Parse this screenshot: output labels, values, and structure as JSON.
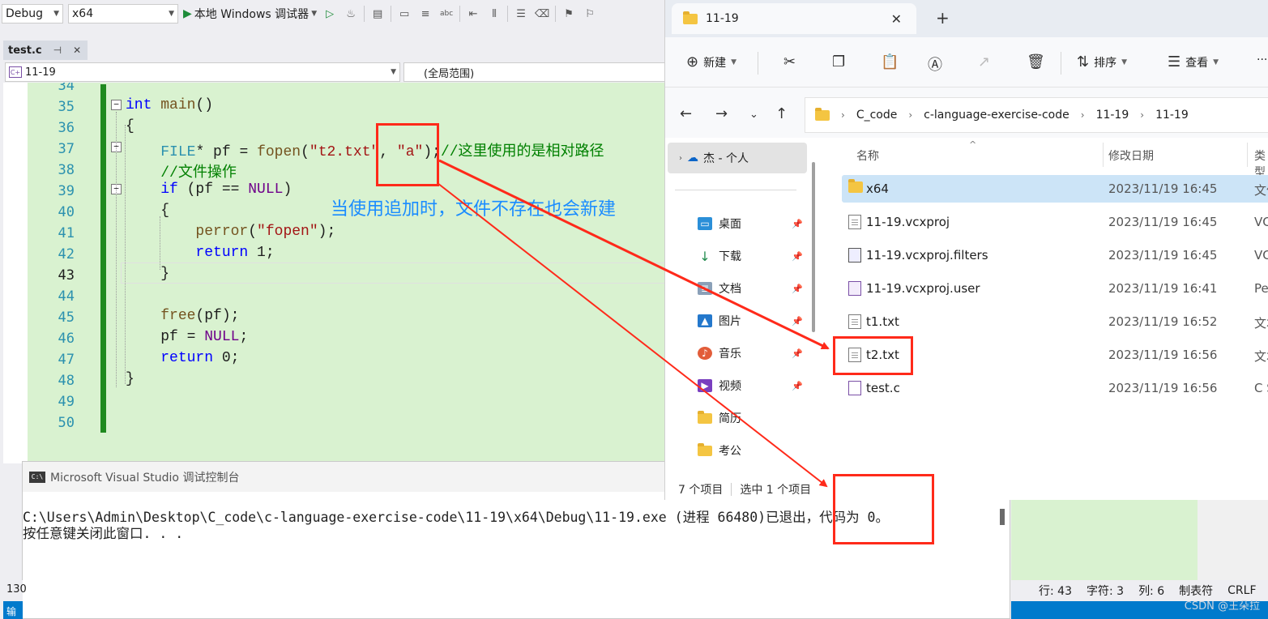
{
  "toolbar": {
    "config": "Debug",
    "platform": "x64",
    "run_label": "本地 Windows 调试器"
  },
  "doc_tab": {
    "name": "test.c",
    "pin": "⊣",
    "close": "✕"
  },
  "navbar": {
    "file_scope": "11-19",
    "global_scope": "(全局范围)"
  },
  "code": {
    "line_numbers": [
      "34",
      "35",
      "36",
      "37",
      "38",
      "39",
      "40",
      "41",
      "42",
      "43",
      "44",
      "45",
      "46",
      "47",
      "48",
      "49",
      "50"
    ],
    "current_line": "43"
  },
  "annotation": "当使用追加时，文件不存在也会新建",
  "console": {
    "title": "Microsoft Visual Studio 调试控制台",
    "icon": "C:\\",
    "line1": "C:\\Users\\Admin\\Desktop\\C_code\\c-language-exercise-code\\11-19\\x64\\Debug\\11-19.exe (进程 66480)已退出，代码为 0。",
    "line2": "按任意键关闭此窗口. . ."
  },
  "explorer": {
    "tab_title": "11-19",
    "cmd": {
      "new": "新建",
      "sort": "排序",
      "view": "查看",
      "more": "···"
    },
    "breadcrumb": [
      "C_code",
      "c-language-exercise-code",
      "11-19",
      "11-19"
    ],
    "nav": {
      "onedrive": "杰 - 个人",
      "items": [
        {
          "label": "桌面"
        },
        {
          "label": "下载"
        },
        {
          "label": "文档"
        },
        {
          "label": "图片"
        },
        {
          "label": "音乐"
        },
        {
          "label": "视频"
        },
        {
          "label": "简历"
        },
        {
          "label": "考公"
        }
      ]
    },
    "columns": {
      "name": "名称",
      "date": "修改日期",
      "type": "类型"
    },
    "files": [
      {
        "name": "x64",
        "date": "2023/11/19 16:45",
        "type": "文件",
        "icon": "folder-icon"
      },
      {
        "name": "11-19.vcxproj",
        "date": "2023/11/19 16:45",
        "type": "VC",
        "icon": "document-icon"
      },
      {
        "name": "11-19.vcxproj.filters",
        "date": "2023/11/19 16:45",
        "type": "VC",
        "icon": "filters-icon"
      },
      {
        "name": "11-19.vcxproj.user",
        "date": "2023/11/19 16:41",
        "type": "Pe",
        "icon": "vs-user-icon"
      },
      {
        "name": "t1.txt",
        "date": "2023/11/19 16:52",
        "type": "文本",
        "icon": "text-file-icon"
      },
      {
        "name": "t2.txt",
        "date": "2023/11/19 16:56",
        "type": "文本",
        "icon": "text-file-icon"
      },
      {
        "name": "test.c",
        "date": "2023/11/19 16:56",
        "type": "C S",
        "icon": "c-source-icon"
      }
    ],
    "status": {
      "count": "7 个项目",
      "selected": "选中 1 个项目"
    }
  },
  "statusbar": {
    "line": "行: 43",
    "char": "字符: 3",
    "col": "列: 6",
    "tab": "制表符",
    "eol": "CRLF",
    "left_num": "130",
    "left_out": "输"
  },
  "watermark": "CSDN @王朵拉"
}
